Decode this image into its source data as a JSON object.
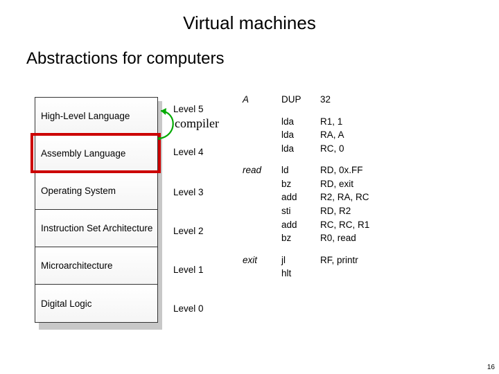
{
  "title": "Virtual machines",
  "subtitle": "Abstractions for computers",
  "annotation": "compiler",
  "pagenum": "16",
  "levels": [
    {
      "name": "High-Level Language",
      "label": "Level 5"
    },
    {
      "name": "Assembly Language",
      "label": "Level 4"
    },
    {
      "name": "Operating System",
      "label": "Level 3"
    },
    {
      "name": "Instruction Set Architecture",
      "label": "Level 2"
    },
    {
      "name": "Microarchitecture",
      "label": "Level 1"
    },
    {
      "name": "Digital Logic",
      "label": "Level 0"
    }
  ],
  "code_blocks": [
    {
      "label": "A",
      "mnem": "DUP",
      "ops": "32"
    },
    {
      "label": "",
      "mnem": "lda\nlda\nlda",
      "ops": "R1, 1\nRA, A\nRC, 0"
    },
    {
      "label": "read",
      "mnem": "ld\nbz\nadd\nsti\nadd\nbz",
      "ops": "RD, 0x.FF\nRD, exit\nR2, RA, RC\nRD, R2\nRC, RC, R1\nR0, read"
    },
    {
      "label": "exit",
      "mnem": "jl\nhlt",
      "ops": "RF, printr"
    }
  ]
}
